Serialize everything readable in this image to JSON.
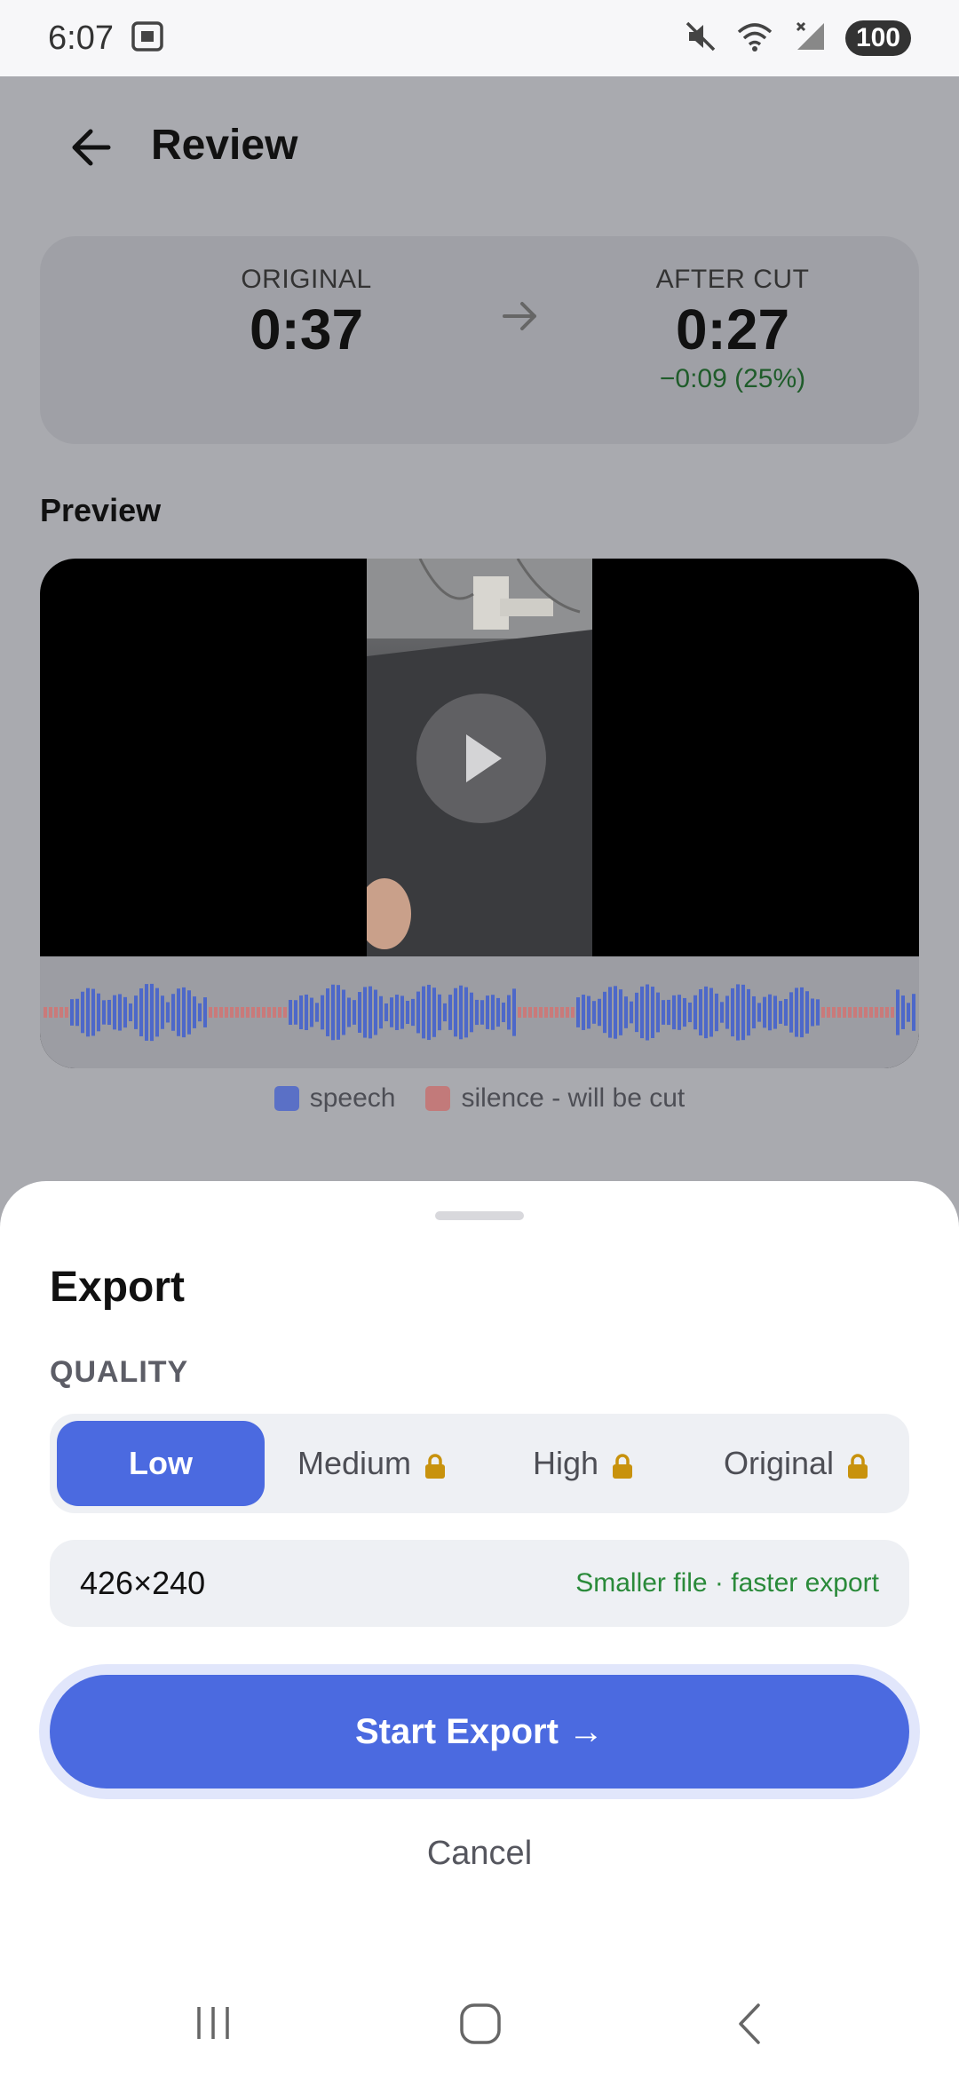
{
  "status_bar": {
    "time": "6:07",
    "battery": "100",
    "icons": [
      "screenshot-icon",
      "mute-icon",
      "wifi-icon",
      "signal-icon",
      "battery-icon"
    ]
  },
  "header": {
    "title": "Review",
    "back_icon": "arrow-left-icon"
  },
  "summary": {
    "original_label": "ORIGINAL",
    "original_value": "0:37",
    "after_label": "AFTER CUT",
    "after_value": "0:27",
    "diff": "−0:09 (25%)",
    "arrow_icon": "arrow-right-icon"
  },
  "preview": {
    "title": "Preview",
    "play_icon": "play-icon"
  },
  "legend": {
    "speech": "speech",
    "silence": "silence - will be cut"
  },
  "colors": {
    "accent": "#4b6ae0",
    "speech": "#4d68c9",
    "silence": "#c97a7a",
    "positive": "#2a8a3a",
    "lock": "#c8920d"
  },
  "sheet": {
    "title": "Export",
    "quality_label": "QUALITY",
    "options": [
      {
        "label": "Low",
        "locked": false,
        "selected": true
      },
      {
        "label": "Medium",
        "locked": true,
        "selected": false
      },
      {
        "label": "High",
        "locked": true,
        "selected": false
      },
      {
        "label": "Original",
        "locked": true,
        "selected": false
      }
    ],
    "resolution": "426×240",
    "resolution_note": "Smaller file · faster export",
    "start_button": "Start Export →",
    "cancel_button": "Cancel"
  },
  "nav_bar": {
    "icons": [
      "recents-icon",
      "home-icon",
      "back-icon"
    ]
  }
}
